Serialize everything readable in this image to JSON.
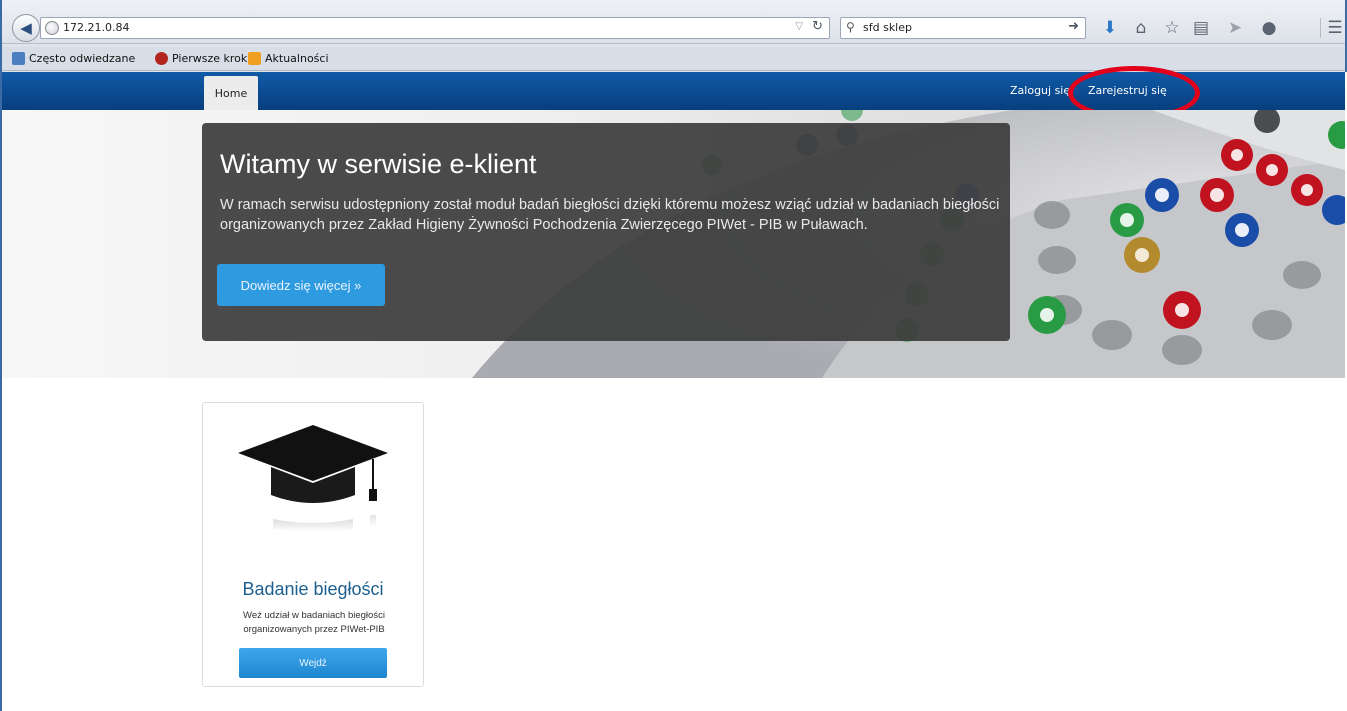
{
  "browser": {
    "url": "172.21.0.84",
    "search_value": "sfd sklep",
    "bookmarks": [
      {
        "label": "Często odwiedzane",
        "icon": "frequent-icon",
        "color": "#4a7fc1"
      },
      {
        "label": "Pierwsze kroki",
        "icon": "firefox-icon",
        "color": "#b3261e"
      },
      {
        "label": "Aktualności",
        "icon": "rss-icon",
        "color": "#f0a020"
      }
    ],
    "toolbar_icons": [
      "download-icon",
      "home-icon",
      "star-icon",
      "reading-list-icon",
      "send-icon",
      "chat-icon",
      "menu-icon"
    ]
  },
  "navbar": {
    "home_label": "Home",
    "login_label": "Zaloguj się",
    "register_label": "Zarejestruj się",
    "highlight_color": "#e3001b"
  },
  "hero": {
    "title": "Witamy w serwisie e-klient",
    "text": "W ramach serwisu udostępniony został moduł badań biegłości dzięki któremu możesz wziąć udział w badaniach biegłości organizowanych przez Zakład Higieny Żywności Pochodzenia Zwierzęcego PIWet - PIB w Puławach.",
    "button_label": "Dowiedz się więcej »"
  },
  "card": {
    "icon": "graduation-cap-icon",
    "title": "Badanie biegłości",
    "text": "Weź udział w badaniach biegłości organizowanych przez PIWet-PIB",
    "button_label": "Wejdź"
  }
}
